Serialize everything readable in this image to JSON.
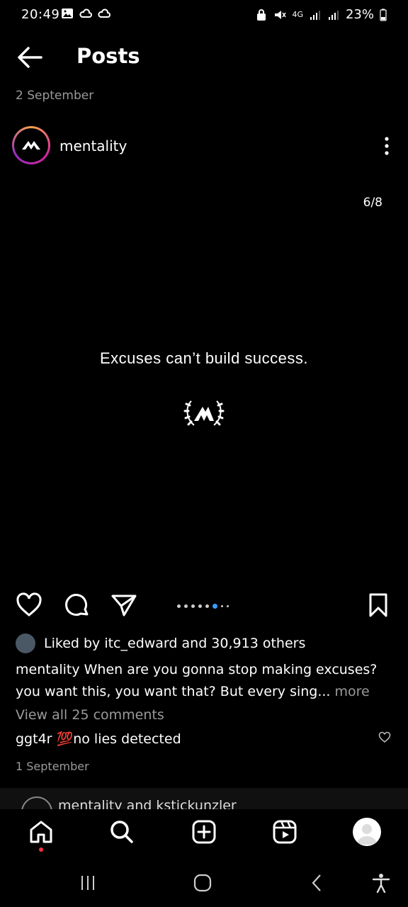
{
  "status_bar": {
    "time": "20:49",
    "network": "4G",
    "battery": "23%",
    "left_icons": [
      "gallery-icon",
      "cloud-sync-icon",
      "cloud-sync-icon"
    ],
    "right_icons": [
      "lock-icon",
      "mute-icon",
      "signal-icon",
      "signal-icon",
      "battery-icon"
    ]
  },
  "header": {
    "title": "Posts",
    "back_icon": "back-arrow-icon"
  },
  "post": {
    "date": "2 September",
    "author": "mentality",
    "counter": "6/8",
    "text": "Excuses can’t build success.",
    "carousel": {
      "total": 8,
      "active": 6
    }
  },
  "engagement": {
    "liked_by_prefix": "Liked by ",
    "liked_by_user": "itc_edward",
    "liked_by_suffix": " and 30,913 others",
    "caption_user": "mentality",
    "caption_text": " When are you gonna stop making excuses? you want this, you want that? But every sing...",
    "caption_more": " more",
    "view_comments": "View all 25 comments",
    "comment_user": "ggt4r",
    "comment_emoji": "💯",
    "comment_text": "no lies detected",
    "comment_date": "1 September"
  },
  "next_post": {
    "label": "mentality and kstickunzler"
  },
  "tabbar": {
    "items": [
      "home-icon",
      "search-icon",
      "create-icon",
      "reels-icon",
      "profile-avatar"
    ]
  },
  "navbar": {
    "items": [
      "recent-apps-icon",
      "home-button-icon",
      "back-icon",
      "accessibility-icon"
    ]
  },
  "colors": {
    "background": "#000000",
    "muted": "#9a9a9a",
    "active_dot": "#3a9cff",
    "notification_dot": "#ff3040"
  }
}
